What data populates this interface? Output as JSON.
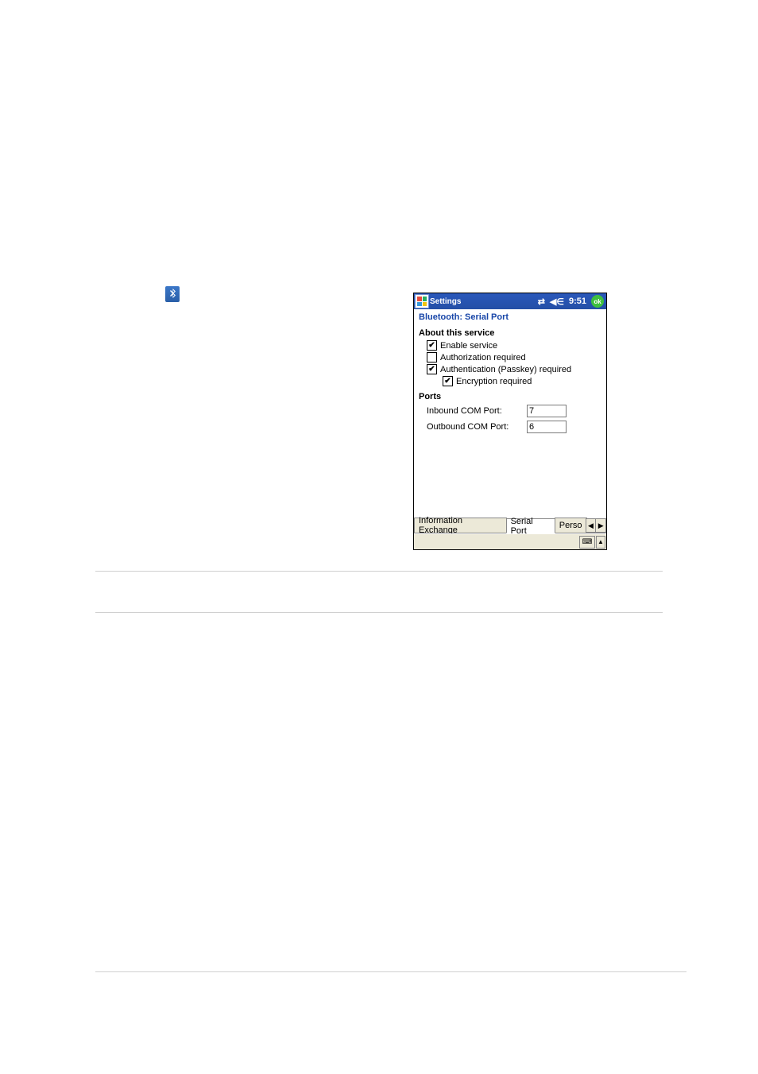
{
  "titlebar": {
    "title": "Settings",
    "time": "9:51",
    "ok": "ok"
  },
  "subtitle": "Bluetooth: Serial Port",
  "about": {
    "heading": "About this service",
    "enable": {
      "label": "Enable service",
      "checked": true
    },
    "auth_req": {
      "label": "Authorization required",
      "checked": false
    },
    "authn": {
      "label": "Authentication (Passkey) required",
      "checked": true
    },
    "encrypt": {
      "label": "Encryption required",
      "checked": true
    }
  },
  "ports": {
    "heading": "Ports",
    "inbound": {
      "label": "Inbound COM Port:",
      "value": "7"
    },
    "outbound": {
      "label": "Outbound COM Port:",
      "value": "6"
    }
  },
  "tabs": {
    "t1": "Information Exchange",
    "t2": "Serial Port",
    "t3": "Perso"
  },
  "nav": {
    "left": "◀",
    "right": "▶",
    "up": "▲",
    "kbd": "⌨"
  }
}
